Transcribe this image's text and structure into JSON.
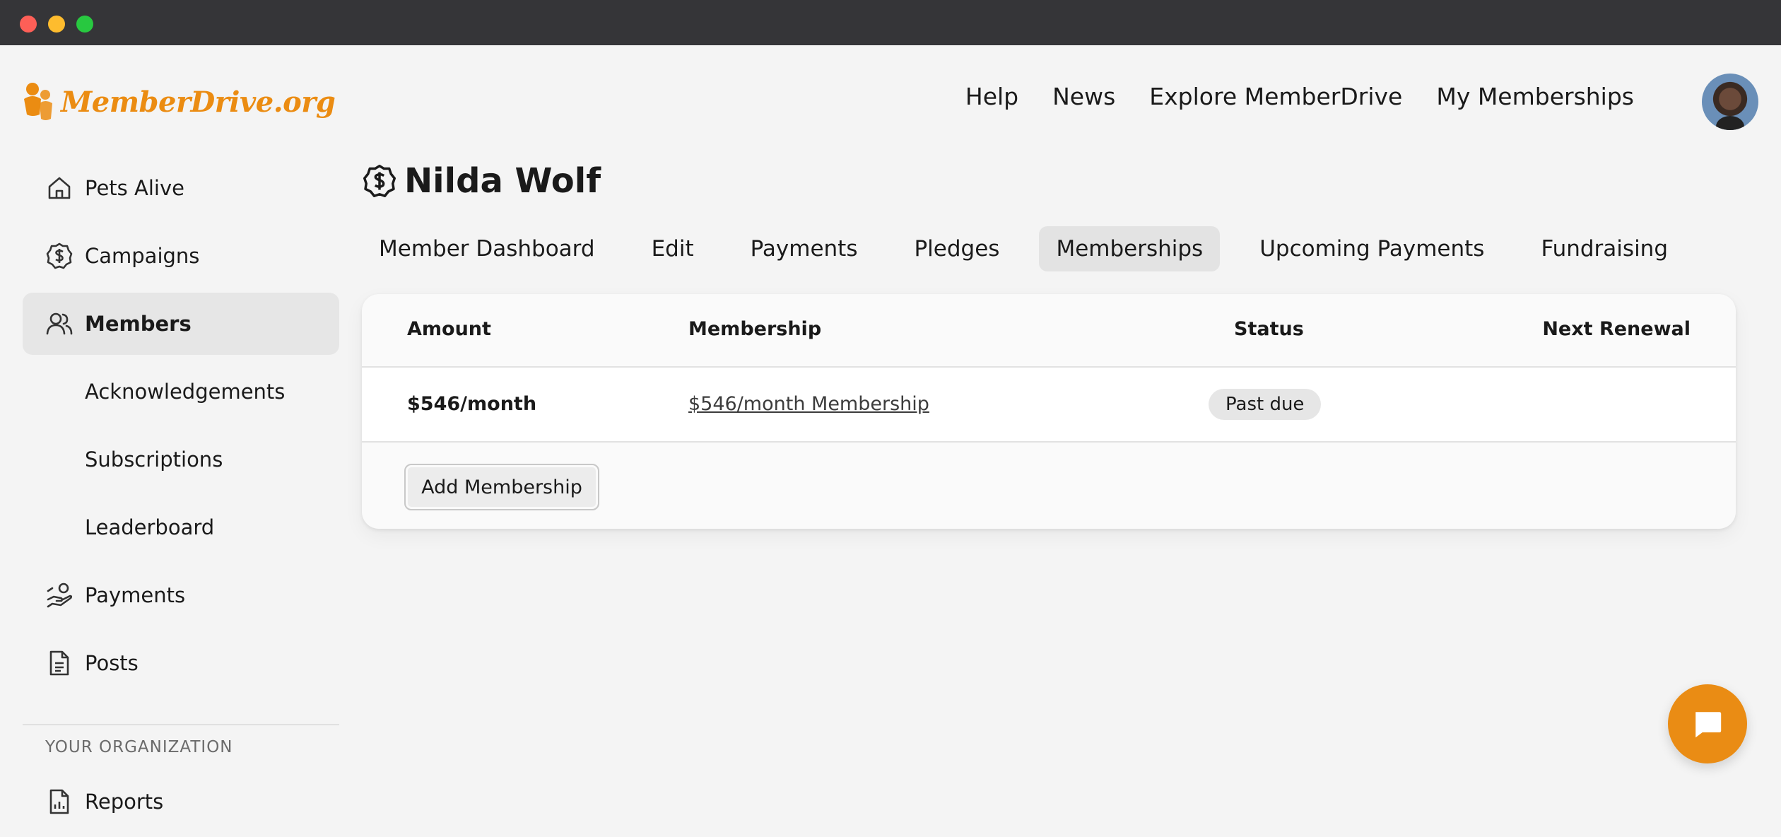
{
  "app": {
    "logo_text": "MemberDrive.org",
    "brand_color": "#eb8c12"
  },
  "topnav": {
    "items": [
      "Help",
      "News",
      "Explore MemberDrive",
      "My Memberships"
    ]
  },
  "sidebar": {
    "items": [
      {
        "label": "Pets Alive",
        "icon": "home-icon"
      },
      {
        "label": "Campaigns",
        "icon": "dollar-badge-icon"
      },
      {
        "label": "Members",
        "icon": "users-icon",
        "active": true
      },
      {
        "label": "Acknowledgements"
      },
      {
        "label": "Subscriptions"
      },
      {
        "label": "Leaderboard"
      },
      {
        "label": "Payments",
        "icon": "hand-money-icon"
      },
      {
        "label": "Posts",
        "icon": "document-icon"
      },
      {
        "label": "Reports",
        "icon": "report-icon"
      }
    ],
    "section_label": "YOUR ORGANIZATION"
  },
  "page": {
    "title": "Nilda Wolf",
    "title_icon": "dollar-badge-icon"
  },
  "tabs": [
    {
      "label": "Member Dashboard"
    },
    {
      "label": "Edit"
    },
    {
      "label": "Payments"
    },
    {
      "label": "Pledges"
    },
    {
      "label": "Memberships",
      "active": true
    },
    {
      "label": "Upcoming Payments"
    },
    {
      "label": "Fundraising"
    }
  ],
  "table": {
    "columns": [
      "Amount",
      "Membership",
      "Status",
      "Next Renewal"
    ],
    "rows": [
      {
        "amount": "$546/month",
        "membership": "$546/month Membership",
        "status": "Past due",
        "next_renewal": ""
      }
    ],
    "add_label": "Add Membership"
  },
  "chat": {
    "icon": "chat-icon",
    "color": "#ea8c14"
  }
}
